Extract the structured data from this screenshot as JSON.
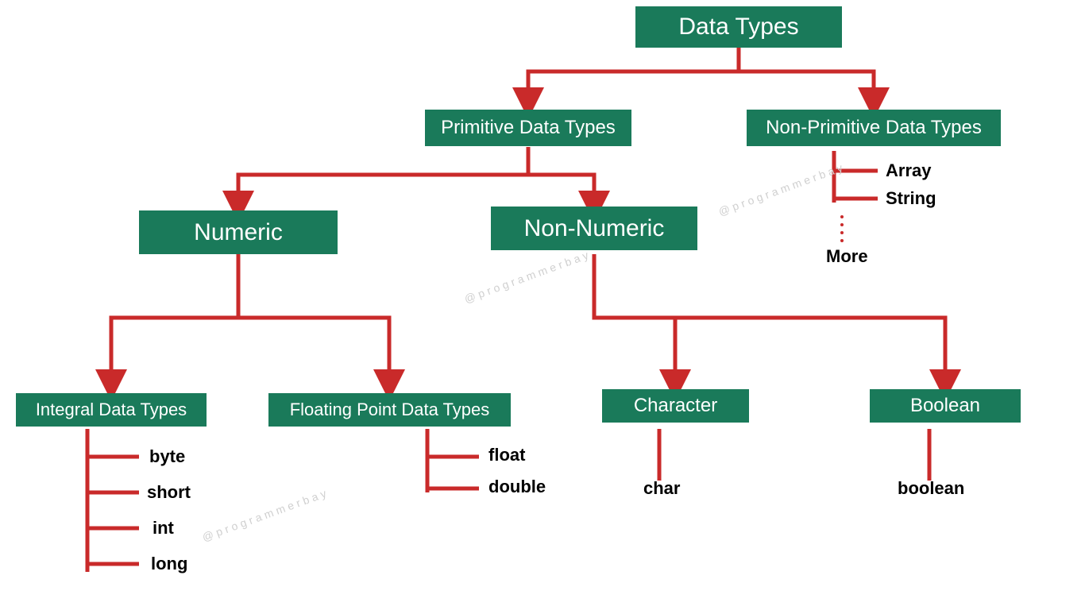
{
  "colors": {
    "box_bg": "#1a7a5a",
    "box_text": "#ffffff",
    "line": "#c92a2a",
    "leaf_text": "#000000",
    "watermark": "#d0d0d0"
  },
  "watermark_text": "@programmerbay",
  "nodes": {
    "root": "Data Types",
    "primitive": "Primitive Data Types",
    "nonprimitive": "Non-Primitive Data Types",
    "numeric": "Numeric",
    "nonnumeric": "Non-Numeric",
    "integral": "Integral Data Types",
    "floating": "Floating Point Data Types",
    "character": "Character",
    "boolean": "Boolean"
  },
  "leaves": {
    "nonprimitive": [
      "Array",
      "String",
      "More"
    ],
    "integral": [
      "byte",
      "short",
      "int",
      "long"
    ],
    "floating": [
      "float",
      "double"
    ],
    "character": [
      "char"
    ],
    "boolean": [
      "boolean"
    ]
  },
  "chart_data": {
    "type": "tree",
    "title": "Data Types",
    "root": {
      "label": "Data Types",
      "children": [
        {
          "label": "Primitive Data Types",
          "children": [
            {
              "label": "Numeric",
              "children": [
                {
                  "label": "Integral Data Types",
                  "children": [
                    {
                      "label": "byte"
                    },
                    {
                      "label": "short"
                    },
                    {
                      "label": "int"
                    },
                    {
                      "label": "long"
                    }
                  ]
                },
                {
                  "label": "Floating Point Data Types",
                  "children": [
                    {
                      "label": "float"
                    },
                    {
                      "label": "double"
                    }
                  ]
                }
              ]
            },
            {
              "label": "Non-Numeric",
              "children": [
                {
                  "label": "Character",
                  "children": [
                    {
                      "label": "char"
                    }
                  ]
                },
                {
                  "label": "Boolean",
                  "children": [
                    {
                      "label": "boolean"
                    }
                  ]
                }
              ]
            }
          ]
        },
        {
          "label": "Non-Primitive Data Types",
          "children": [
            {
              "label": "Array"
            },
            {
              "label": "String"
            },
            {
              "label": "More"
            }
          ]
        }
      ]
    }
  }
}
